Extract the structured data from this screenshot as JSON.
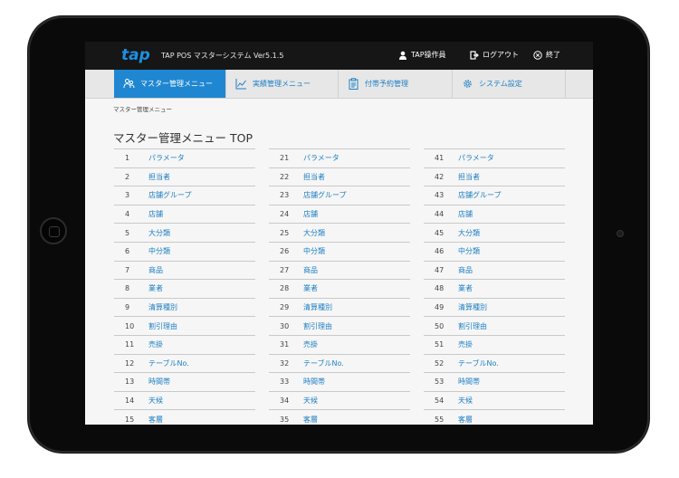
{
  "app": {
    "logo": "tap",
    "title": "TAP POS マスターシステム Ver5.1.5",
    "user_label": "TAP操作員",
    "logout_label": "ログアウト",
    "exit_label": "終了"
  },
  "nav": [
    {
      "label": "マスター管理メニュー",
      "icon": "people-icon",
      "active": true
    },
    {
      "label": "実績管理メニュー",
      "icon": "chart-line-icon",
      "active": false
    },
    {
      "label": "付帯予約管理",
      "icon": "clipboard-icon",
      "active": false
    },
    {
      "label": "システム設定",
      "icon": "gear-icon",
      "active": false
    }
  ],
  "breadcrumb": "マスター管理メニュー",
  "page_title": "マスター管理メニュー TOP",
  "columns": [
    [
      {
        "num": "1",
        "label": "パラメータ"
      },
      {
        "num": "2",
        "label": "担当者"
      },
      {
        "num": "3",
        "label": "店舗グループ"
      },
      {
        "num": "4",
        "label": "店舗"
      },
      {
        "num": "5",
        "label": "大分類"
      },
      {
        "num": "6",
        "label": "中分類"
      },
      {
        "num": "7",
        "label": "商品"
      },
      {
        "num": "8",
        "label": "業者"
      },
      {
        "num": "9",
        "label": "清算種別"
      },
      {
        "num": "10",
        "label": "割引理由"
      },
      {
        "num": "11",
        "label": "売掛"
      },
      {
        "num": "12",
        "label": "テーブルNo."
      },
      {
        "num": "13",
        "label": "時間帯"
      },
      {
        "num": "14",
        "label": "天候"
      },
      {
        "num": "15",
        "label": "客層"
      }
    ],
    [
      {
        "num": "21",
        "label": "パラメータ"
      },
      {
        "num": "22",
        "label": "担当者"
      },
      {
        "num": "23",
        "label": "店舗グループ"
      },
      {
        "num": "24",
        "label": "店舗"
      },
      {
        "num": "25",
        "label": "大分類"
      },
      {
        "num": "26",
        "label": "中分類"
      },
      {
        "num": "27",
        "label": "商品"
      },
      {
        "num": "28",
        "label": "業者"
      },
      {
        "num": "29",
        "label": "清算種別"
      },
      {
        "num": "30",
        "label": "割引理由"
      },
      {
        "num": "31",
        "label": "売掛"
      },
      {
        "num": "32",
        "label": "テーブルNo."
      },
      {
        "num": "33",
        "label": "時間帯"
      },
      {
        "num": "34",
        "label": "天候"
      },
      {
        "num": "35",
        "label": "客層"
      }
    ],
    [
      {
        "num": "41",
        "label": "パラメータ"
      },
      {
        "num": "42",
        "label": "担当者"
      },
      {
        "num": "43",
        "label": "店舗グループ"
      },
      {
        "num": "44",
        "label": "店舗"
      },
      {
        "num": "45",
        "label": "大分類"
      },
      {
        "num": "46",
        "label": "中分類"
      },
      {
        "num": "47",
        "label": "商品"
      },
      {
        "num": "48",
        "label": "業者"
      },
      {
        "num": "49",
        "label": "清算種別"
      },
      {
        "num": "50",
        "label": "割引理由"
      },
      {
        "num": "51",
        "label": "売掛"
      },
      {
        "num": "52",
        "label": "テーブルNo."
      },
      {
        "num": "53",
        "label": "時間帯"
      },
      {
        "num": "54",
        "label": "天候"
      },
      {
        "num": "55",
        "label": "客層"
      }
    ]
  ],
  "colors": {
    "accent": "#1f87d1",
    "link": "#1d7fc4",
    "topbar": "#161616",
    "navbar": "#e7e7e7"
  }
}
